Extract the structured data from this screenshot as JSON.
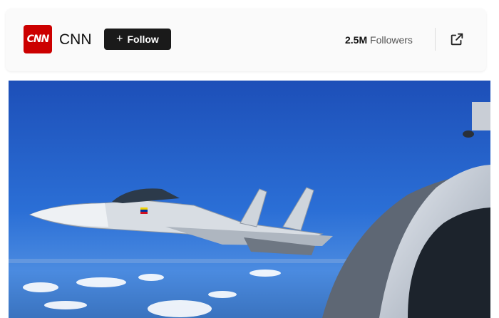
{
  "channel": {
    "logo_text": "CNN",
    "name": "CNN",
    "follow_label": "Follow",
    "followers_count": "2.5M",
    "followers_label": "Followers"
  },
  "colors": {
    "brand_red": "#cc0000",
    "button_bg": "#1a1a1a",
    "sky": "#1f5fc7"
  },
  "icons": {
    "plus": "plus-icon",
    "share": "external-link-icon"
  }
}
